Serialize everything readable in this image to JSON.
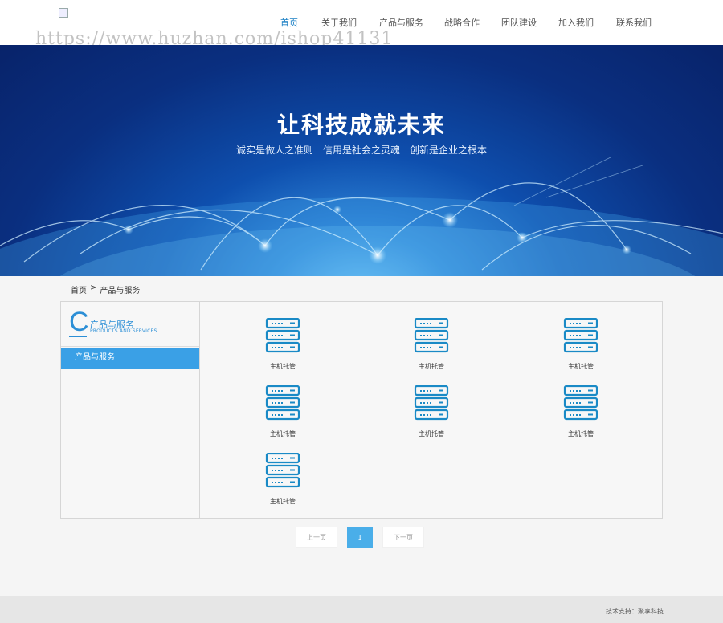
{
  "header": {
    "watermark": "https://www.huzhan.com/ishop41131",
    "nav": [
      {
        "label": "首页",
        "active": true
      },
      {
        "label": "关于我们",
        "active": false
      },
      {
        "label": "产品与服务",
        "active": false
      },
      {
        "label": "战略合作",
        "active": false
      },
      {
        "label": "团队建设",
        "active": false
      },
      {
        "label": "加入我们",
        "active": false
      },
      {
        "label": "联系我们",
        "active": false
      }
    ]
  },
  "banner": {
    "title": "让科技成就未来",
    "subtitle": "诚实是做人之准则　信用是社会之灵魂　创新是企业之根本"
  },
  "breadcrumb": {
    "home": "首页",
    "separator": ">",
    "current": "产品与服务"
  },
  "sidebar": {
    "letter": "C",
    "title": "产品与服务",
    "subtitle_en": "PRODUCTS AND SERVICES",
    "items": [
      {
        "label": "产品与服务",
        "active": true
      }
    ]
  },
  "products": [
    {
      "label": "主机托管",
      "icon": "server-icon"
    },
    {
      "label": "主机托管",
      "icon": "server-icon"
    },
    {
      "label": "主机托管",
      "icon": "server-icon"
    },
    {
      "label": "主机托管",
      "icon": "server-icon"
    },
    {
      "label": "主机托管",
      "icon": "server-icon"
    },
    {
      "label": "主机托管",
      "icon": "server-icon"
    },
    {
      "label": "主机托管",
      "icon": "server-icon"
    }
  ],
  "pagination": {
    "prev": "上一页",
    "current": "1",
    "next": "下一页"
  },
  "footer": {
    "text": "技术支持：聚享科技"
  },
  "colors": {
    "accent": "#2c8fd6",
    "active_nav": "#1a7fc4",
    "sidebar_active": "#3aa0e6",
    "pager_active": "#4aaee9"
  }
}
